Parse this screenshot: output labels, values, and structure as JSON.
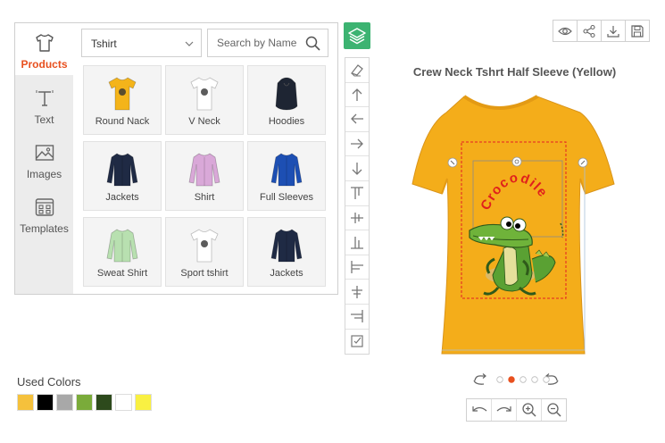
{
  "sidebar": {
    "tabs": [
      {
        "label": "Products",
        "icon": "tshirt-icon",
        "active": true
      },
      {
        "label": "Text",
        "icon": "text-icon",
        "active": false
      },
      {
        "label": "Images",
        "icon": "image-icon",
        "active": false
      },
      {
        "label": "Templates",
        "icon": "templates-icon",
        "active": false
      }
    ]
  },
  "filters": {
    "category_value": "Tshirt",
    "search_placeholder": "Search by Name"
  },
  "products": [
    {
      "name": "Round Nack",
      "color": "#f4b41a"
    },
    {
      "name": "V Neck",
      "color": "#ffffff"
    },
    {
      "name": "Hoodies",
      "color": "#1e2533"
    },
    {
      "name": "Jackets",
      "color": "#1f2a44"
    },
    {
      "name": "Shirt",
      "color": "#d9a8d8"
    },
    {
      "name": "Full Sleeves",
      "color": "#1d4fb3"
    },
    {
      "name": "Sweat Shirt",
      "color": "#b8e0b0"
    },
    {
      "name": "Sport tshirt",
      "color": "#ffffff"
    },
    {
      "name": "Jackets",
      "color": "#1f2a44"
    }
  ],
  "toolbar": {
    "tools": [
      "eraser-icon",
      "move-up-icon",
      "move-left-icon",
      "move-right-icon",
      "move-down-icon",
      "align-top-icon",
      "align-middle-vertical-icon",
      "align-bottom-icon",
      "align-left-icon",
      "align-center-horizontal-icon",
      "align-right-icon",
      "select-all-icon"
    ]
  },
  "header_actions": [
    "preview-icon",
    "share-icon",
    "download-icon",
    "save-icon"
  ],
  "product_title": "Crew Neck Tshrt Half Sleeve (Yellow)",
  "design": {
    "text": "Crocodile",
    "text_color": "#e0201c",
    "shirt_color": "#f4ad1a"
  },
  "used_colors": {
    "title": "Used Colors",
    "colors": [
      "#f5c13c",
      "#000000",
      "#a8a8a8",
      "#7aab3a",
      "#2d4a1c",
      "#ffffff",
      "#f9f042"
    ]
  },
  "views": {
    "count": 5,
    "active_index": 1
  }
}
